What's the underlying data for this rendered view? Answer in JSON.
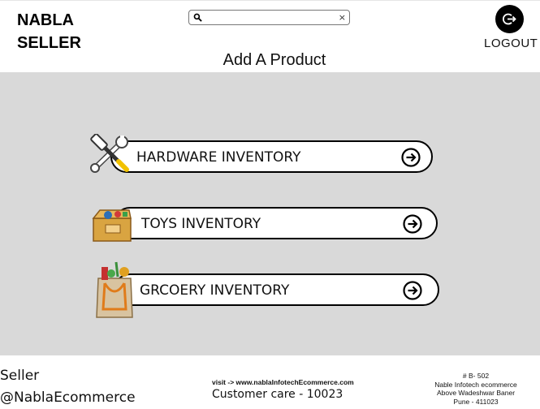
{
  "brand": {
    "line1": "NABLA",
    "line2": "SELLER"
  },
  "search": {
    "value": "",
    "placeholder": "",
    "clear_glyph": "×"
  },
  "header": {
    "logout_label": "LOGOUT",
    "page_title": "Add A Product"
  },
  "inventories": [
    {
      "label": "HARDWARE INVENTORY",
      "icon": "tools-icon"
    },
    {
      "label": "TOYS INVENTORY",
      "icon": "toy-box-icon"
    },
    {
      "label": "GRCOERY INVENTORY",
      "icon": "grocery-bag-icon"
    }
  ],
  "footer": {
    "seller_line1": "Seller",
    "seller_line2": "@NablaEcommerce",
    "visit_link": "visit -> www.nablaInfotechEcommerce.com",
    "customer_care": "Customer care - 10023",
    "address": [
      "# B- 502",
      "Nable Infotech ecommerce",
      "Above Wadeshwar Baner",
      "Pune - 411023"
    ]
  },
  "colors": {
    "main_bg": "#d9d9d9",
    "button_bg": "#ffffff",
    "border": "#000000"
  }
}
